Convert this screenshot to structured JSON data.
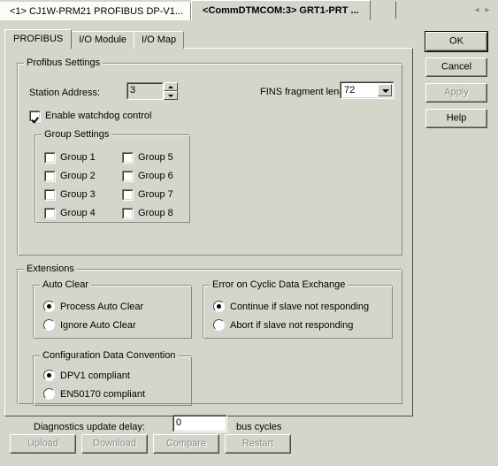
{
  "window": {
    "document_tabs": [
      {
        "label": "<1> CJ1W-PRM21 PROFIBUS DP-V1...",
        "active": false
      },
      {
        "label": "<CommDTMCOM:3> GRT1-PRT ...",
        "active": true
      }
    ],
    "scroll_left_icon": "triangle-left-icon",
    "scroll_right_icon": "triangle-right-icon"
  },
  "tabs": [
    {
      "label": "PROFIBUS",
      "selected": true
    },
    {
      "label": "I/O Module",
      "selected": false
    },
    {
      "label": "I/O Map",
      "selected": false
    }
  ],
  "profibus_settings": {
    "title": "Profibus Settings",
    "station_address": {
      "label": "Station Address:",
      "value": "3",
      "spinner_up_icon": "triangle-up-icon",
      "spinner_down_icon": "triangle-down-icon"
    },
    "fins_fragment_length": {
      "label": "FINS fragment length:",
      "value": "72",
      "dropdown_icon": "chevron-down-icon"
    },
    "enable_watchdog": {
      "label": "Enable watchdog control",
      "checked": true
    },
    "group_settings": {
      "title": "Group Settings",
      "groups": [
        {
          "label": "Group 1",
          "checked": false
        },
        {
          "label": "Group 2",
          "checked": false
        },
        {
          "label": "Group 3",
          "checked": false
        },
        {
          "label": "Group 4",
          "checked": false
        },
        {
          "label": "Group 5",
          "checked": false
        },
        {
          "label": "Group 6",
          "checked": false
        },
        {
          "label": "Group 7",
          "checked": false
        },
        {
          "label": "Group 8",
          "checked": false
        }
      ]
    }
  },
  "extensions": {
    "title": "Extensions",
    "auto_clear": {
      "title": "Auto Clear",
      "options": [
        {
          "label": "Process Auto Clear",
          "selected": true
        },
        {
          "label": "Ignore Auto Clear",
          "selected": false
        }
      ]
    },
    "error_on_cyclic": {
      "title": "Error on Cyclic Data Exchange",
      "options": [
        {
          "label": "Continue if slave not responding",
          "selected": true
        },
        {
          "label": "Abort if slave not responding",
          "selected": false
        }
      ]
    },
    "config_data_convention": {
      "title": "Configuration Data Convention",
      "options": [
        {
          "label": "DPV1 compliant",
          "selected": true
        },
        {
          "label": "EN50170 compliant",
          "selected": false
        }
      ]
    },
    "diagnostics_update_delay": {
      "label": "Diagnostics update delay:",
      "value": "0",
      "units": "bus cycles"
    }
  },
  "side_buttons": [
    {
      "label": "OK",
      "enabled": true,
      "default": true
    },
    {
      "label": "Cancel",
      "enabled": true,
      "default": false
    },
    {
      "label": "Apply",
      "enabled": false,
      "default": false
    },
    {
      "label": "Help",
      "enabled": true,
      "default": false
    }
  ],
  "bottom_buttons": [
    {
      "label": "Upload",
      "enabled": false
    },
    {
      "label": "Download",
      "enabled": false
    },
    {
      "label": "Compare",
      "enabled": false
    },
    {
      "label": "Restart",
      "enabled": false
    }
  ],
  "colors": {
    "background": "#d4d6cc",
    "field": "#ffffff",
    "shadow": "#4c4c46",
    "highlight": "#ffffff",
    "disabled_text": "#8a8a82"
  }
}
